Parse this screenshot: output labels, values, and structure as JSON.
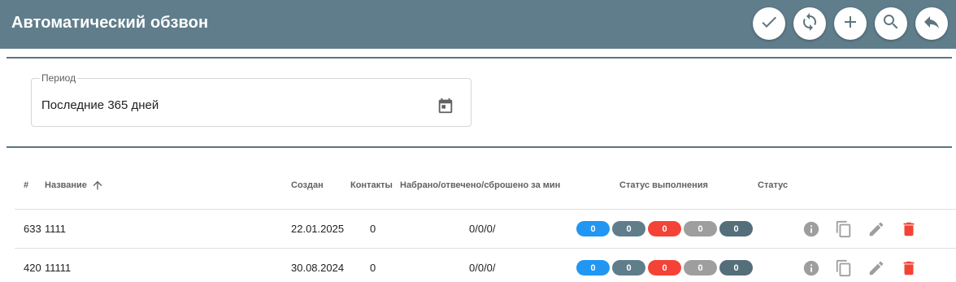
{
  "header": {
    "title": "Автоматический обзвон",
    "buttons": [
      {
        "name": "confirm-button",
        "icon": "check-icon"
      },
      {
        "name": "refresh-button",
        "icon": "sync-icon"
      },
      {
        "name": "add-button",
        "icon": "plus-icon"
      },
      {
        "name": "search-button",
        "icon": "search-icon"
      },
      {
        "name": "back-button",
        "icon": "reply-icon"
      }
    ],
    "colors": {
      "bar": "#607d8b",
      "button_bg": "#ffffff",
      "button_icon": "#5f7480"
    }
  },
  "filter": {
    "period_label": "Период",
    "period_value": "Последние 365 дней",
    "icon": "calendar-icon"
  },
  "table": {
    "columns": {
      "num": "#",
      "name": "Название",
      "created": "Создан",
      "contacts": "Контакты",
      "dialed": "Набрано/отвечено/сброшено за мин",
      "progress": "Статус выполнения",
      "status": "Статус"
    },
    "sort": {
      "column": "name",
      "direction": "asc",
      "icon": "arrow-up-icon"
    },
    "status_colors": [
      "#2196f3",
      "#607d8b",
      "#f44336",
      "#9e9e9e",
      "#546e7a"
    ],
    "rows": [
      {
        "id": "633",
        "name": "1111",
        "created": "22.01.2025",
        "contacts": "0",
        "dialed": "0/0/0/",
        "badges": [
          "0",
          "0",
          "0",
          "0",
          "0"
        ],
        "status": ""
      },
      {
        "id": "420",
        "name": "11111",
        "created": "30.08.2024",
        "contacts": "0",
        "dialed": "0/0/0/",
        "badges": [
          "0",
          "0",
          "0",
          "0",
          "0"
        ],
        "status": ""
      }
    ],
    "row_actions": [
      "info-icon",
      "copy-icon",
      "edit-icon",
      "delete-icon"
    ]
  }
}
